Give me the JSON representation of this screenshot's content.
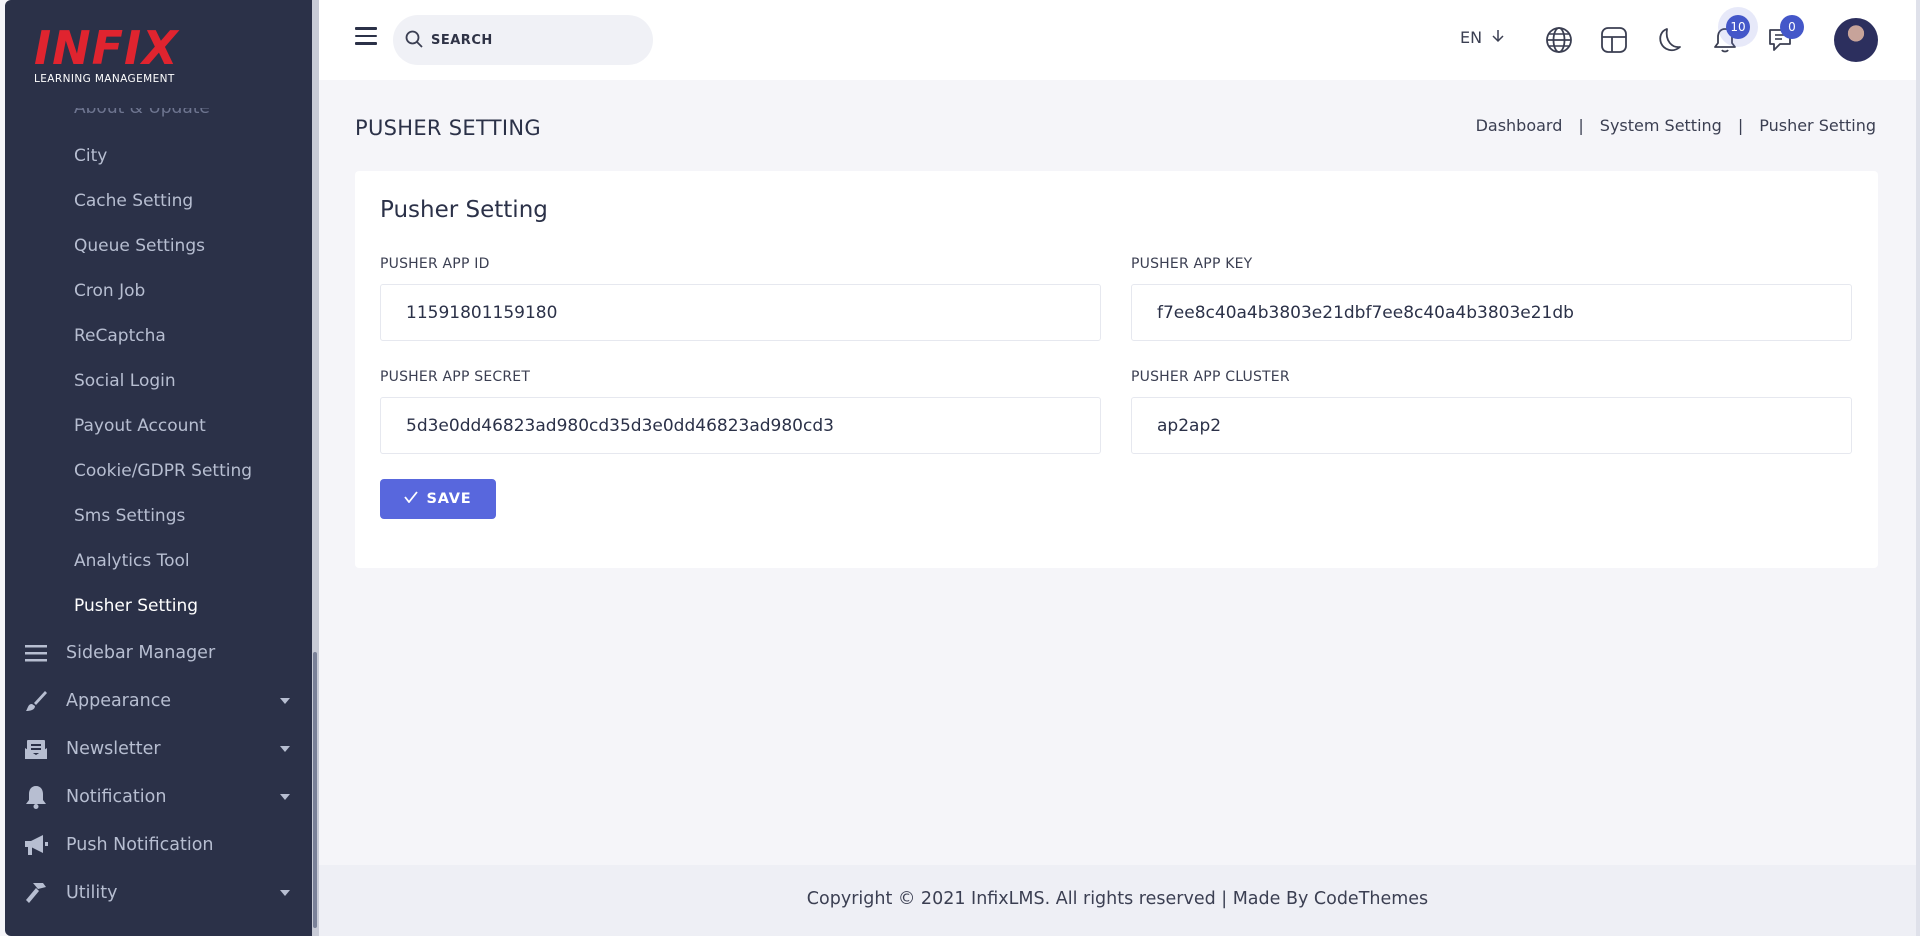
{
  "brand": {
    "name": "INFIX",
    "tagline": "LEARNING MANAGEMENT"
  },
  "sidebar": {
    "partial_item": "About & Update",
    "sub_items": [
      {
        "label": "City"
      },
      {
        "label": "Cache Setting"
      },
      {
        "label": "Queue Settings"
      },
      {
        "label": "Cron Job"
      },
      {
        "label": "ReCaptcha"
      },
      {
        "label": "Social Login"
      },
      {
        "label": "Payout Account"
      },
      {
        "label": "Cookie/GDPR Setting"
      },
      {
        "label": "Sms Settings"
      },
      {
        "label": "Analytics Tool"
      },
      {
        "label": "Pusher Setting",
        "active": true
      }
    ],
    "main_items": [
      {
        "label": "Sidebar Manager",
        "icon": "list-icon",
        "has_caret": false
      },
      {
        "label": "Appearance",
        "icon": "brush-icon",
        "has_caret": true
      },
      {
        "label": "Newsletter",
        "icon": "mail-open-icon",
        "has_caret": true
      },
      {
        "label": "Notification",
        "icon": "bell-icon",
        "has_caret": true
      },
      {
        "label": "Push Notification",
        "icon": "megaphone-icon",
        "has_caret": false
      },
      {
        "label": "Utility",
        "icon": "hammer-icon",
        "has_caret": true
      }
    ]
  },
  "header": {
    "search_placeholder": "SEARCH",
    "language": "EN",
    "notification_count": "10",
    "message_count": "0"
  },
  "page": {
    "title": "PUSHER SETTING",
    "breadcrumb": [
      "Dashboard",
      "System Setting",
      "Pusher Setting"
    ],
    "card_title": "Pusher Setting",
    "fields": {
      "app_id": {
        "label": "PUSHER APP ID",
        "value": "11591801159180"
      },
      "app_key": {
        "label": "PUSHER APP KEY",
        "value": "f7ee8c40a4b3803e21dbf7ee8c40a4b3803e21db"
      },
      "app_secret": {
        "label": "PUSHER APP SECRET",
        "value": "5d3e0dd46823ad980cd35d3e0dd46823ad980cd3"
      },
      "app_cluster": {
        "label": "PUSHER APP CLUSTER",
        "value": "ap2ap2"
      }
    },
    "save_label": "SAVE"
  },
  "footer": {
    "text": "Copyright © 2021 InfixLMS. All rights reserved | Made By CodeThemes"
  },
  "colors": {
    "sidebar_bg": "#2b3148",
    "brand_red": "#e0242f",
    "primary": "#5867dd",
    "badge": "#4457c9"
  }
}
